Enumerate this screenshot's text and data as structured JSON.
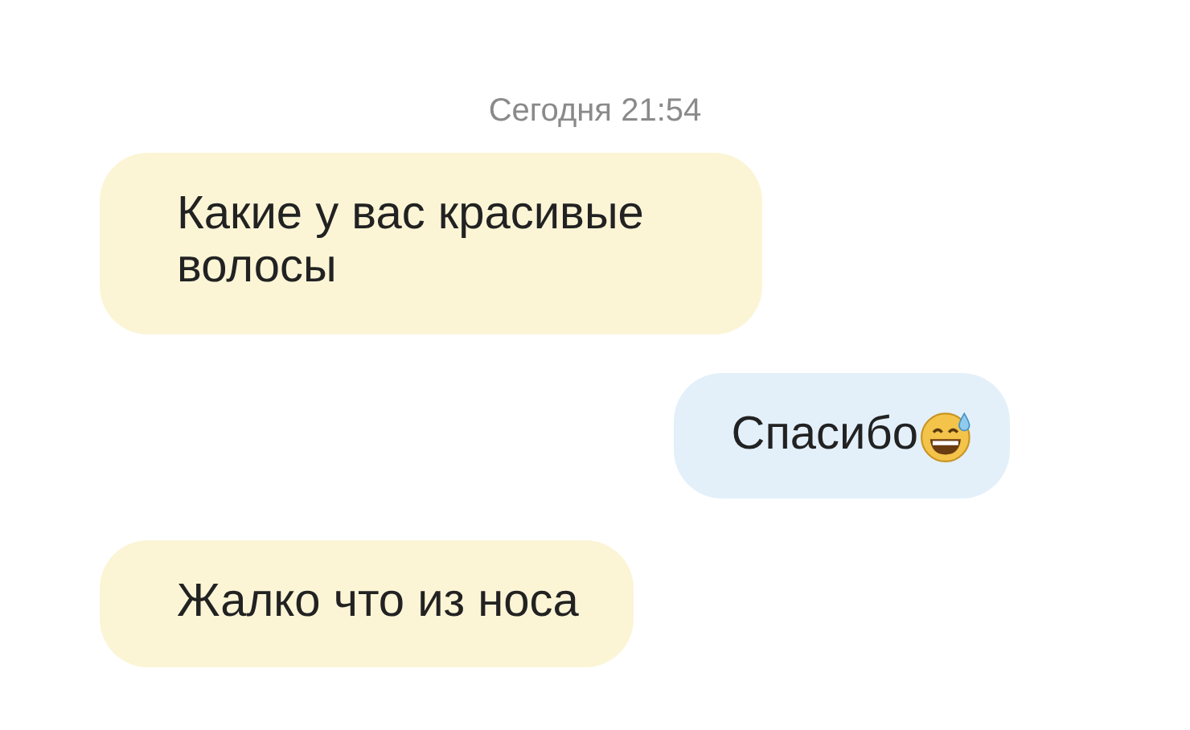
{
  "timestamp": "Сегодня 21:54",
  "messages": [
    {
      "kind": "incoming",
      "text": "Какие у вас красивые волосы",
      "has_emoji": false
    },
    {
      "kind": "outgoing",
      "text": "Спасибо",
      "has_emoji": true
    },
    {
      "kind": "incoming",
      "text": "Жалко что из носа",
      "has_emoji": false
    }
  ]
}
